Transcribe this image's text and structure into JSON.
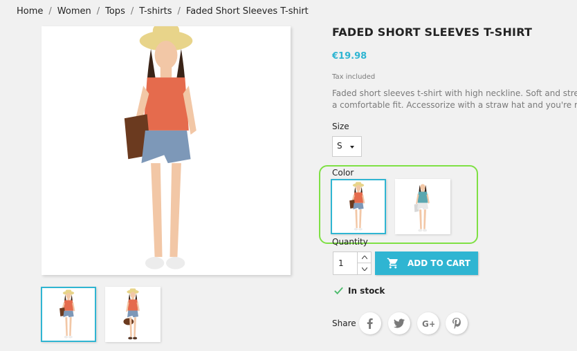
{
  "breadcrumb": [
    "Home",
    "Women",
    "Tops",
    "T-shirts",
    "Faded Short Sleeves T-shirt"
  ],
  "product": {
    "title": "FADED SHORT SLEEVES T-SHIRT",
    "price": "€19.98",
    "tax_note": "Tax included",
    "description_line1": "Faded short sleeves t-shirt with high neckline. Soft and stretchy material for",
    "description_line2": "a comfortable fit. Accessorize with a straw hat and you're ready for summer!"
  },
  "size": {
    "label": "Size",
    "selected": "S"
  },
  "color": {
    "label": "Color",
    "swatches": [
      "orange",
      "blue"
    ],
    "selected_index": 0
  },
  "quantity": {
    "label": "Quantity",
    "value": "1"
  },
  "cart_button": {
    "label": "ADD TO CART"
  },
  "stock": {
    "label": "In stock"
  },
  "share": {
    "label": "Share",
    "networks": [
      "facebook",
      "twitter",
      "google-plus",
      "pinterest"
    ]
  },
  "colors": {
    "accent": "#2fb5d2",
    "highlight": "#7ee043",
    "background": "#f1f1f1"
  }
}
